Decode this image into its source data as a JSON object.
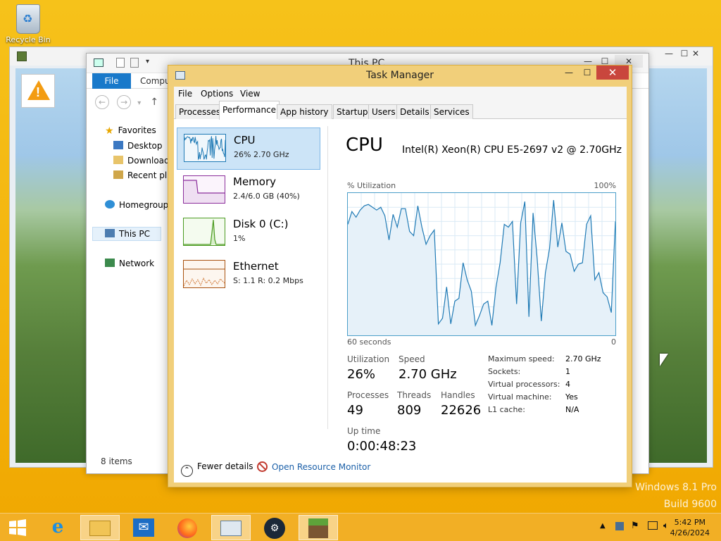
{
  "desktop": {
    "recycle_bin_label": "Recycle Bin",
    "watermark_line1": "Windows 8.1 Pro",
    "watermark_line2": "Build 9600"
  },
  "explorer": {
    "title": "This PC",
    "ribbon_file": "File",
    "ribbon_computer": "Comput",
    "nav": {
      "favorites": "Favorites",
      "desktop": "Desktop",
      "downloads": "Downloads",
      "recent_places": "Recent plac",
      "homegroup": "Homegroup",
      "this_pc": "This PC",
      "network": "Network"
    },
    "status": "8 items"
  },
  "task_manager": {
    "title": "Task Manager",
    "menu": [
      "File",
      "Options",
      "View"
    ],
    "tabs": [
      "Processes",
      "Performance",
      "App history",
      "Startup",
      "Users",
      "Details",
      "Services"
    ],
    "active_tab": "Performance",
    "resources": [
      {
        "name": "CPU",
        "sub": "26%  2.70 GHz",
        "color": "#1f7ab5"
      },
      {
        "name": "Memory",
        "sub": "2.4/6.0 GB (40%)",
        "color": "#8b2e9b"
      },
      {
        "name": "Disk 0 (C:)",
        "sub": "1%",
        "color": "#4a9a1f"
      },
      {
        "name": "Ethernet",
        "sub": "S: 1.1  R: 0.2 Mbps",
        "color": "#a8510e"
      }
    ],
    "detail": {
      "heading": "CPU",
      "model": "Intel(R) Xeon(R) CPU E5-2697 v2 @ 2.70GHz",
      "util_label": "% Utilization",
      "max_label": "100%",
      "time_label": "60 seconds",
      "zero_label": "0",
      "stats": {
        "utilization_label": "Utilization",
        "utilization_value": "26%",
        "speed_label": "Speed",
        "speed_value": "2.70 GHz",
        "processes_label": "Processes",
        "processes_value": "49",
        "threads_label": "Threads",
        "threads_value": "809",
        "handles_label": "Handles",
        "handles_value": "22626",
        "uptime_label": "Up time",
        "uptime_value": "0:00:48:23"
      },
      "specs": [
        {
          "k": "Maximum speed:",
          "v": "2.70 GHz"
        },
        {
          "k": "Sockets:",
          "v": "1"
        },
        {
          "k": "Virtual processors:",
          "v": "4"
        },
        {
          "k": "Virtual machine:",
          "v": "Yes"
        },
        {
          "k": "L1 cache:",
          "v": "N/A"
        }
      ],
      "cpu_history_percent": [
        78,
        87,
        83,
        88,
        91,
        92,
        90,
        88,
        90,
        84,
        67,
        85,
        76,
        89,
        89,
        73,
        70,
        91,
        76,
        64,
        70,
        74,
        8,
        12,
        34,
        8,
        24,
        26,
        51,
        39,
        31,
        7,
        14,
        22,
        24,
        7,
        34,
        51,
        78,
        76,
        80,
        22,
        79,
        94,
        13,
        86,
        54,
        10,
        44,
        61,
        95,
        62,
        79,
        59,
        57,
        45,
        50,
        51,
        78,
        84,
        39,
        44,
        30,
        27,
        16,
        80
      ]
    },
    "footer": {
      "fewer_details": "Fewer details",
      "open_resource_monitor": "Open Resource Monitor"
    }
  },
  "taskbar": {
    "time": "5:42 PM",
    "date": "4/26/2024"
  }
}
